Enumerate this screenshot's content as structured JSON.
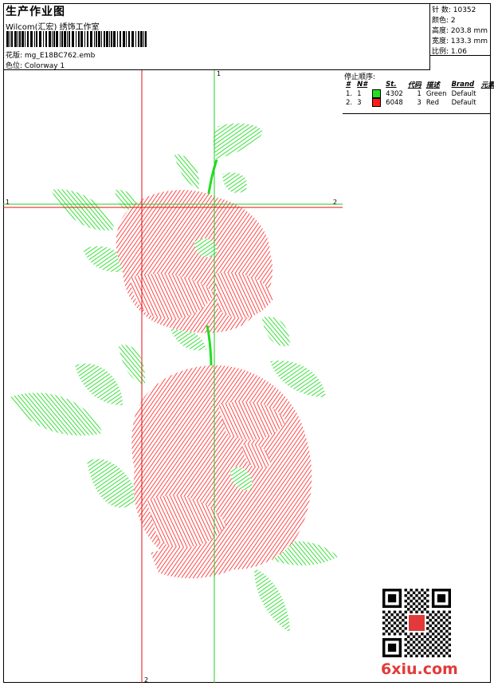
{
  "header": {
    "title": "生产作业图",
    "company": "Wilcom(汇宏) 绣饰工作室",
    "design_name": "花版: mg_E18BC762.emb",
    "colorway": "色位: Colorway 1"
  },
  "stats": {
    "stitches": "针 数: 10352",
    "colors": "颜色: 2",
    "height": "高度: 203.8 mm",
    "width": "宽度: 133.3 mm",
    "scale": "比例: 1.06"
  },
  "sequence": {
    "title": "停止顺序:",
    "headers": [
      "#",
      "N#",
      "St.",
      "代码",
      "描述",
      "Brand",
      "元素"
    ],
    "rows": [
      {
        "num": "1.",
        "n": "1",
        "code": "4302",
        "st": "1",
        "desc": "Green",
        "brand": "Default",
        "color": "#22dd22"
      },
      {
        "num": "2.",
        "n": "3",
        "code": "6048",
        "st": "3",
        "desc": "Red",
        "brand": "Default",
        "color": "#ff1a1a"
      }
    ]
  },
  "guides": {
    "v_green_top": "1",
    "h_left": "1",
    "h_right": "2",
    "v_red_bottom": "2"
  },
  "colors": {
    "thread_green": "#22dd22",
    "thread_red": "#ff1a1a",
    "guide_green": "#22cc22",
    "guide_red": "#e01010"
  },
  "watermark": "6xiu.com"
}
